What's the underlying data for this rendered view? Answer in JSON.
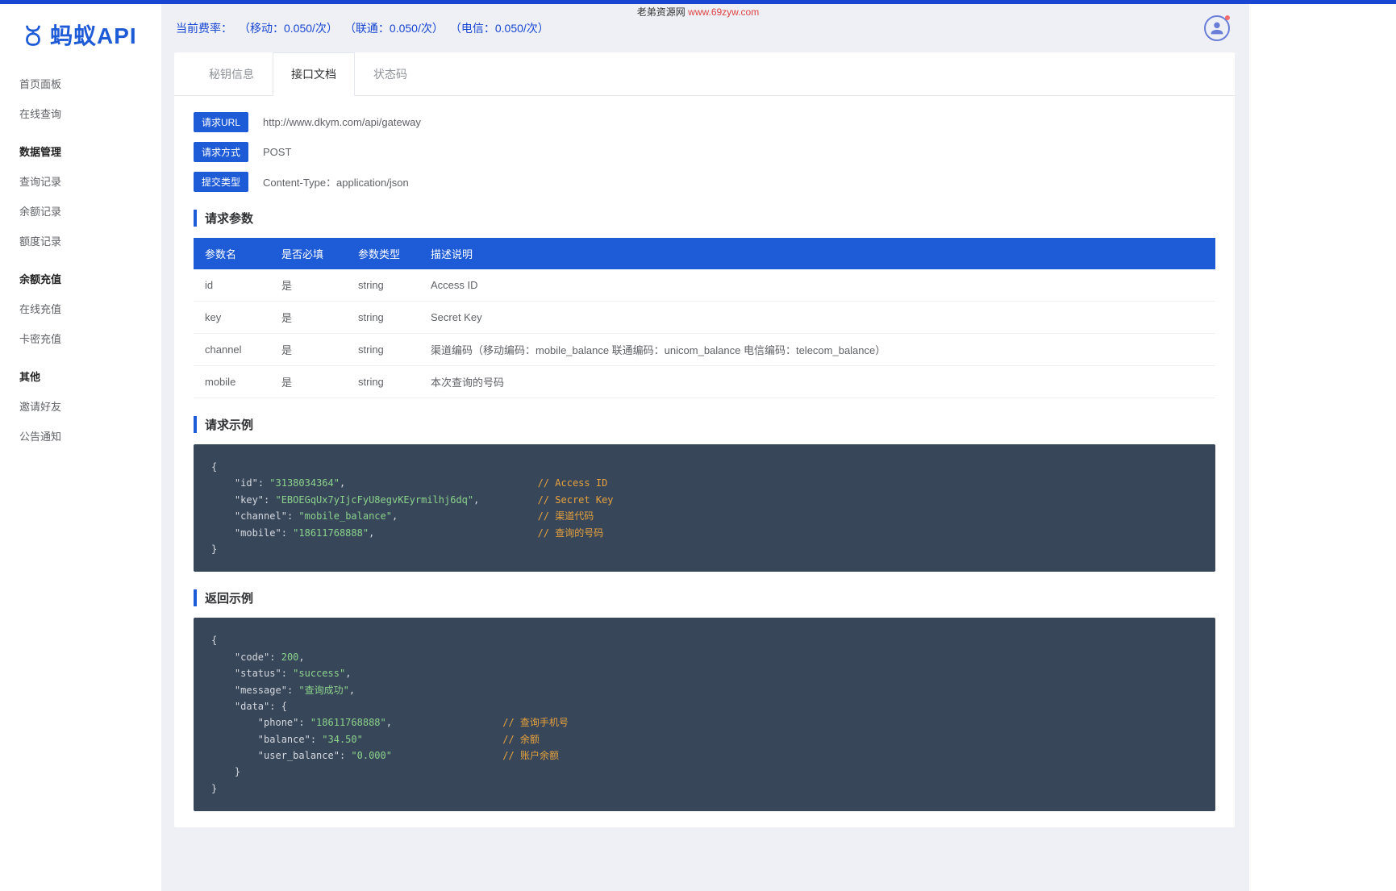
{
  "watermark": {
    "label": "老弟资源网",
    "url": "www.69zyw.com"
  },
  "brand": "蚂蚁API",
  "rates": {
    "label": "当前费率：",
    "items": [
      {
        "text": "（移动：0.050/次）"
      },
      {
        "text": "（联通：0.050/次）"
      },
      {
        "text": "（电信：0.050/次）"
      }
    ]
  },
  "sidebar": {
    "items": [
      {
        "label": "首页面板",
        "type": "link"
      },
      {
        "label": "在线查询",
        "type": "link"
      },
      {
        "label": "数据管理",
        "type": "header"
      },
      {
        "label": "查询记录",
        "type": "link"
      },
      {
        "label": "余额记录",
        "type": "link"
      },
      {
        "label": "额度记录",
        "type": "link"
      },
      {
        "label": "余额充值",
        "type": "header"
      },
      {
        "label": "在线充值",
        "type": "link"
      },
      {
        "label": "卡密充值",
        "type": "link"
      },
      {
        "label": "其他",
        "type": "header"
      },
      {
        "label": "邀请好友",
        "type": "link"
      },
      {
        "label": "公告通知",
        "type": "link"
      }
    ]
  },
  "tabs": [
    {
      "label": "秘钥信息",
      "active": false
    },
    {
      "label": "接口文档",
      "active": true
    },
    {
      "label": "状态码",
      "active": false
    }
  ],
  "doc": {
    "info": [
      {
        "label": "请求URL",
        "value": "http://www.dkym.com/api/gateway"
      },
      {
        "label": "请求方式",
        "value": "POST"
      },
      {
        "label": "提交类型",
        "value": "Content-Type：application/json"
      }
    ],
    "sections": {
      "params_title": "请求参数",
      "request_example_title": "请求示例",
      "response_example_title": "返回示例"
    },
    "params_header": [
      "参数名",
      "是否必填",
      "参数类型",
      "描述说明"
    ],
    "params": [
      {
        "name": "id",
        "required": "是",
        "type": "string",
        "desc": "Access ID"
      },
      {
        "name": "key",
        "required": "是",
        "type": "string",
        "desc": "Secret Key"
      },
      {
        "name": "channel",
        "required": "是",
        "type": "string",
        "desc": "渠道编码（移动编码：mobile_balance 联通编码：unicom_balance 电信编码：telecom_balance）"
      },
      {
        "name": "mobile",
        "required": "是",
        "type": "string",
        "desc": "本次查询的号码"
      }
    ],
    "request_example": {
      "id": "3138034364",
      "key": "EBOEGqUx7yIjcFyU8egvKEyrmilhj6dq",
      "channel": "mobile_balance",
      "mobile": "18611768888",
      "comments": {
        "id": "// Access ID",
        "key": "// Secret Key",
        "channel": "// 渠道代码",
        "mobile": "// 查询的号码"
      }
    },
    "response_example": {
      "code": 200,
      "status": "success",
      "message": "查询成功",
      "data": {
        "phone": "18611768888",
        "balance": "34.50",
        "user_balance": "0.000"
      },
      "comments": {
        "phone": "// 查询手机号",
        "balance": "// 余额",
        "user_balance": "// 账户余额"
      }
    }
  }
}
